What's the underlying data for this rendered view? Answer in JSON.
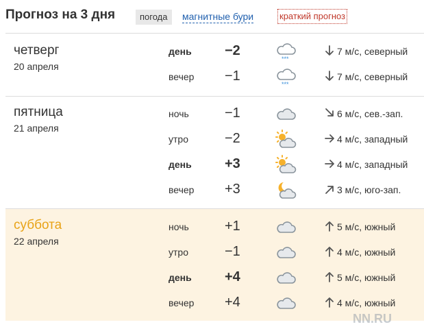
{
  "header": {
    "title": "Прогноз на 3 дня",
    "tab_weather": "погода",
    "tab_magnetic": "магнитные бури",
    "tab_brief": "краткий прогноз"
  },
  "days": [
    {
      "name": "четверг",
      "date": "20 апреля",
      "rows": [
        {
          "period": "день",
          "temp": "−2",
          "icon": "cloud-snow-icon",
          "wind_dir": "down",
          "wind": "7 м/с, северный"
        },
        {
          "period": "вечер",
          "temp": "−1",
          "icon": "cloud-snow-icon",
          "wind_dir": "down",
          "wind": "7 м/с, северный"
        }
      ]
    },
    {
      "name": "пятница",
      "date": "21 апреля",
      "rows": [
        {
          "period": "ночь",
          "temp": "−1",
          "icon": "cloud-icon",
          "wind_dir": "down-right",
          "wind": "6 м/с, сев.-зап."
        },
        {
          "period": "утро",
          "temp": "−2",
          "icon": "sun-cloud-icon",
          "wind_dir": "right",
          "wind": "4 м/с, западный"
        },
        {
          "period": "день",
          "temp": "+3",
          "icon": "sun-cloud-icon",
          "wind_dir": "right",
          "wind": "4 м/с, западный"
        },
        {
          "period": "вечер",
          "temp": "+3",
          "icon": "moon-cloud-icon",
          "wind_dir": "up-right",
          "wind": "3 м/с, юго-зап."
        }
      ]
    },
    {
      "name": "суббота",
      "date": "22 апреля",
      "rows": [
        {
          "period": "ночь",
          "temp": "+1",
          "icon": "cloud-icon",
          "wind_dir": "up",
          "wind": "5 м/с, южный"
        },
        {
          "period": "утро",
          "temp": "−1",
          "icon": "cloud-icon",
          "wind_dir": "up",
          "wind": "4 м/с, южный"
        },
        {
          "period": "день",
          "temp": "+4",
          "icon": "cloud-icon",
          "wind_dir": "up",
          "wind": "5 м/с, южный"
        },
        {
          "period": "вечер",
          "temp": "+4",
          "icon": "cloud-icon",
          "wind_dir": "up",
          "wind": "4 м/с, южный"
        }
      ]
    }
  ],
  "logo": "NN.RU",
  "colors": {
    "highlight_bg": "#fdf3e1",
    "highlight_text": "#e8a317",
    "link": "#1f5fae",
    "brief": "#c0392b"
  }
}
